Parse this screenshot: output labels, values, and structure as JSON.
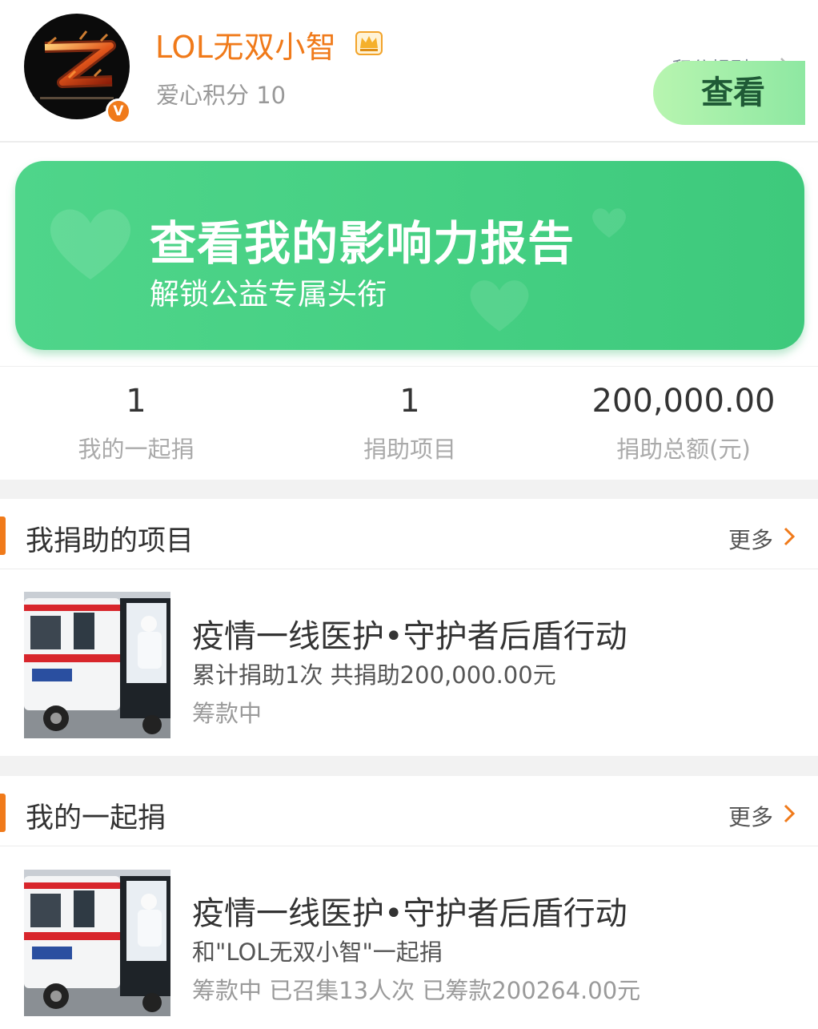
{
  "profile": {
    "username": "LOL无双小智",
    "points": "爱心积分 10",
    "rules_link": "积分规则",
    "verified_badge": "V",
    "icons": [
      "avatar",
      "crown-icon",
      "verified-badge-icon",
      "chevron-right-icon"
    ]
  },
  "banner": {
    "title": "查看我的影响力报告",
    "subtitle": "解锁公益专属头衔",
    "button": "查看"
  },
  "stats": [
    {
      "value": "1",
      "label": "我的一起捐"
    },
    {
      "value": "1",
      "label": "捐助项目"
    },
    {
      "value": "200,000.00",
      "label": "捐助总额(元)"
    }
  ],
  "donated_projects": {
    "title": "我捐助的项目",
    "more": "更多",
    "items": [
      {
        "title": "疫情一线医护•守护者后盾行动",
        "detail": "累计捐助1次 共捐助200,000.00元",
        "status": "筹款中"
      }
    ]
  },
  "group_donations": {
    "title": "我的一起捐",
    "more": "更多",
    "items": [
      {
        "title": "疫情一线医护•守护者后盾行动",
        "detail": "和\"LOL无双小智\"一起捐",
        "status": "筹款中 已召集13人次 已筹款200264.00元"
      }
    ]
  },
  "colors": {
    "accent": "#f07a1a",
    "banner_green": "#46d083",
    "banner_button": "#a6efaa",
    "text_primary": "#333333",
    "text_secondary": "#999999",
    "page_gap": "#f2f2f2"
  }
}
